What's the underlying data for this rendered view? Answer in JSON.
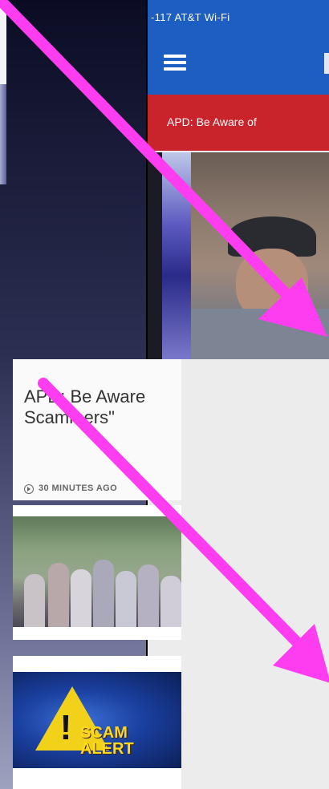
{
  "status_bar": {
    "text": "-117 AT&T Wi-Fi"
  },
  "nav": {
    "menu_icon": "hamburger-menu-icon"
  },
  "breaking_banner": {
    "text": "APD: Be Aware of"
  },
  "article": {
    "headline_line1": "APD: Be Aware",
    "headline_line2": "Scammers\"",
    "timestamp": "30 MINUTES AGO"
  },
  "scam_graphic": {
    "line1": "SCAM",
    "line2": "ALERT"
  },
  "colors": {
    "nav_blue": "#1d5ec2",
    "breaking_red": "#c9242b",
    "arrow_magenta": "#ff3df0",
    "warning_yellow": "#f1d11a"
  }
}
